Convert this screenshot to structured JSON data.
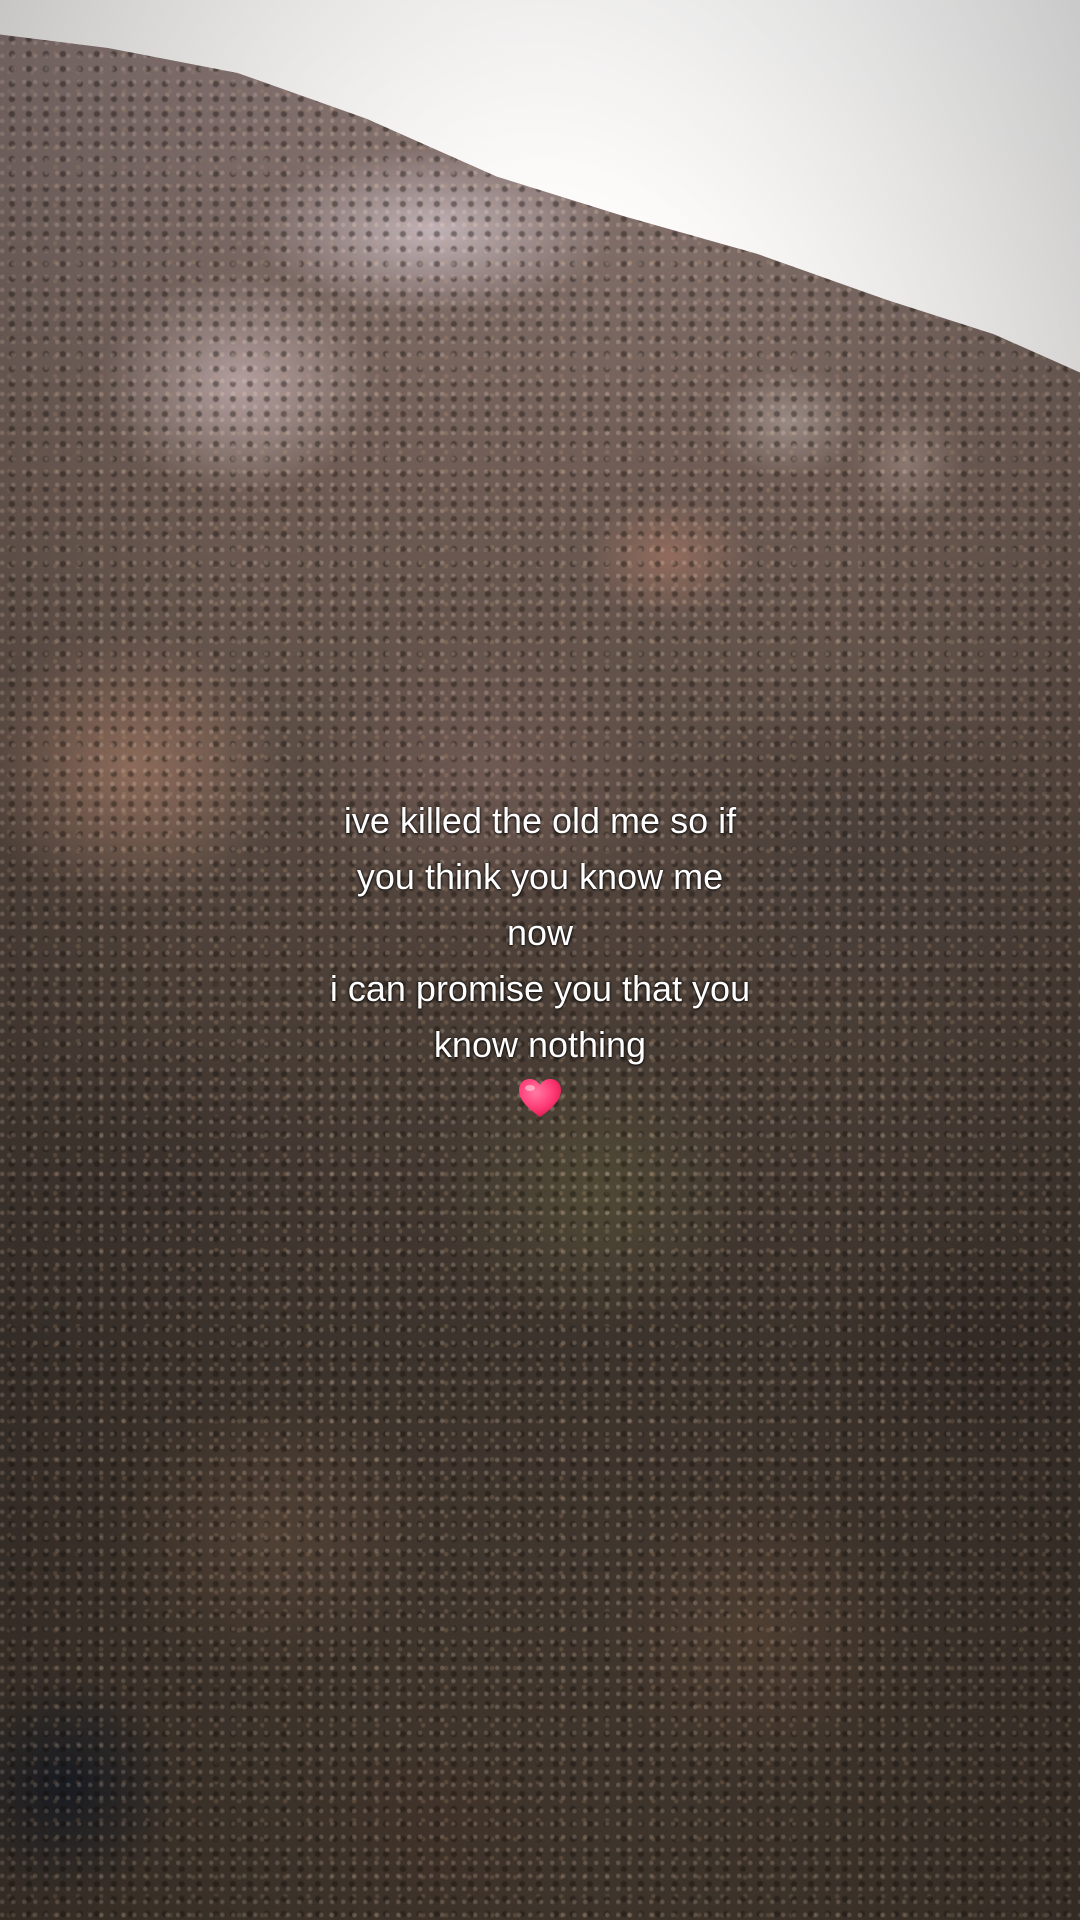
{
  "caption": {
    "lines": [
      "ive killed the old me so if",
      "you think you know me",
      "now",
      "i can promise you that you",
      "know nothing"
    ],
    "emoji": "pink-heart-icon"
  },
  "colors": {
    "text": "#ffffff",
    "heart": "#ff3b76",
    "sky": "#f7f3f0"
  }
}
